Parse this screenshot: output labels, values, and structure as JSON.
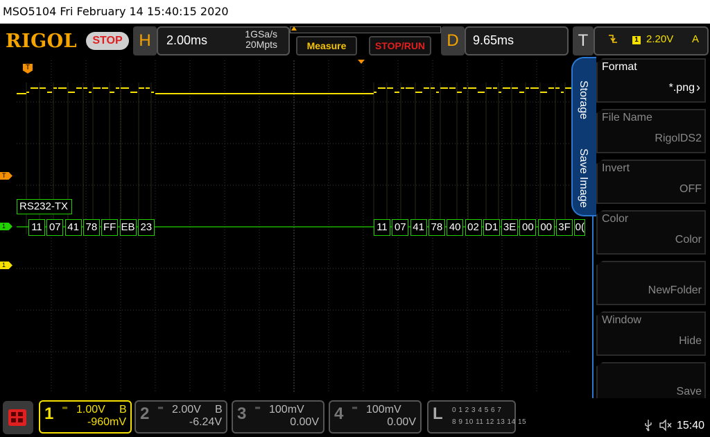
{
  "title_bar": {
    "text": "MSO5104  Fri February 14 15:40:15 2020"
  },
  "header": {
    "logo": "RIGOL",
    "run_state": "STOP",
    "horizontal": {
      "letter": "H",
      "timebase": "2.00ms",
      "sample_rate": "1GSa/s",
      "memory_depth": "20Mpts"
    },
    "trigger_bar_pattern": "^^^^^^^^^^^^^^^^^^^^^^^^^^^^^^^^^^^^^^^^^^^^^^^^^^^^^^^^^^^^^^^^^^^^^^^^^^^^^^^^^^^^^^^^",
    "measure_label": "Measure",
    "stoprun_label": "STOP/RUN",
    "delay": {
      "letter": "D",
      "value": "9.65ms"
    },
    "trigger": {
      "letter": "T",
      "slope_icon": "falling-edge-icon",
      "source": "1",
      "level": "2.20V",
      "mode": "A"
    }
  },
  "markers": {
    "trigger_level": "T",
    "ch1_decode": "1",
    "ch1": "1",
    "trigger_position": "T"
  },
  "decode": {
    "label": "RS232-TX",
    "group1": [
      "11",
      "07",
      "41",
      "78",
      "FF",
      "EB",
      "23"
    ],
    "group2": [
      "11",
      "07",
      "41",
      "78",
      "40",
      "02",
      "D1",
      "3E",
      "00",
      "00",
      "3F",
      "0("
    ]
  },
  "side_menu": {
    "tab_storage": "Storage",
    "tab_save_image": "Save Image",
    "items": [
      {
        "label": "Format",
        "value": "*.png"
      },
      {
        "label": "File Name",
        "value": "RigolDS2"
      },
      {
        "label": "Invert",
        "value": "OFF"
      },
      {
        "label": "Color",
        "value": "Color"
      },
      {
        "label": "",
        "value": "NewFolder"
      },
      {
        "label": "Window",
        "value": "Hide"
      },
      {
        "label": "",
        "value": "Save"
      }
    ]
  },
  "channels": [
    {
      "num": "1",
      "scale": "1.00V",
      "bw": "B",
      "offset": "-960mV"
    },
    {
      "num": "2",
      "scale": "2.00V",
      "bw": "B",
      "offset": "-6.24V"
    },
    {
      "num": "3",
      "scale": "100mV",
      "bw": "",
      "offset": "0.00V"
    },
    {
      "num": "4",
      "scale": "100mV",
      "bw": "",
      "offset": "0.00V"
    }
  ],
  "logic": {
    "letter": "L",
    "row1": "0 1 2 3   4 5 6 7",
    "row2": "8 9 10 11 12 13 14 15"
  },
  "status": {
    "clock": "15:40"
  },
  "colors": {
    "ch1": "#f5e000",
    "decode": "#22d000",
    "trigger": "#f59000",
    "menu_accent": "#2b78d0"
  }
}
